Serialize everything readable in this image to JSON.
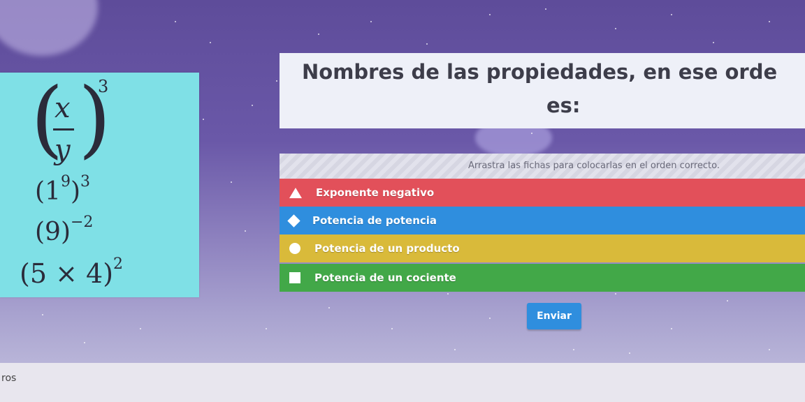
{
  "expressions": {
    "e1": {
      "numerator": "x",
      "denominator": "y",
      "exponent": "3"
    },
    "e2": {
      "base": "1",
      "inner_exp": "9",
      "exponent": "3"
    },
    "e3": {
      "base": "9",
      "exponent": "−2"
    },
    "e4": {
      "base": "5 × 4",
      "exponent": "2"
    }
  },
  "question": {
    "title_line1": "Nombres de las propiedades, en ese orde",
    "title_line2": "es:"
  },
  "instruction": "Arrastra las fichas para colocarlas en el orden correcto.",
  "tiles": [
    {
      "label": "Exponente negativo",
      "icon": "triangle-icon",
      "color": "#e2505a"
    },
    {
      "label": "Potencia de potencia",
      "icon": "diamond-icon",
      "color": "#2f8ede"
    },
    {
      "label": "Potencia de un producto",
      "icon": "circle-icon",
      "color": "#d9ba3a"
    },
    {
      "label": "Potencia de un cociente",
      "icon": "square-icon",
      "color": "#42a848"
    }
  ],
  "submit_label": "Enviar",
  "footer_text": "ros"
}
